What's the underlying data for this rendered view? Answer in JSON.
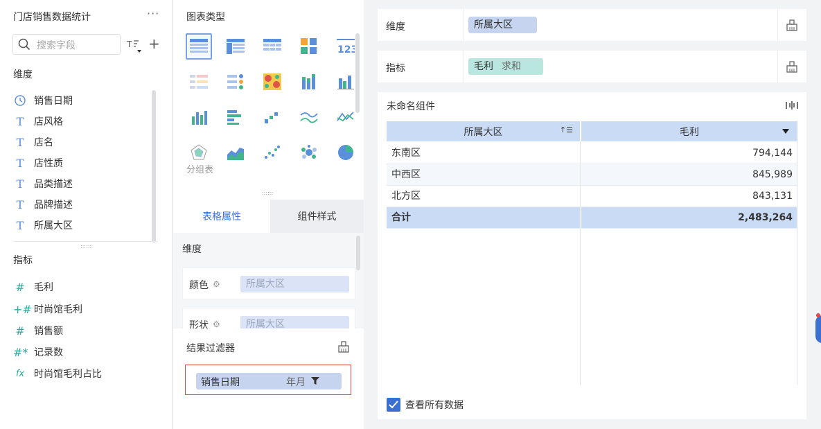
{
  "left": {
    "title": "门店销售数据统计",
    "more": "···",
    "search_placeholder": "搜索字段",
    "dimensions_label": "维度",
    "dimensions": [
      "销售日期",
      "店风格",
      "店名",
      "店性质",
      "品类描述",
      "品牌描述",
      "所属大区"
    ],
    "metrics_label": "指标",
    "metrics": [
      "毛利",
      "时尚馆毛利",
      "销售额",
      "记录数",
      "时尚馆毛利占比"
    ]
  },
  "mid": {
    "chart_types_label": "图表类型",
    "selected_chart_label": "分组表",
    "tabs": [
      "表格属性",
      "组件样式"
    ],
    "dimension_label": "维度",
    "props": [
      {
        "label": "颜色",
        "value": "所属大区"
      },
      {
        "label": "形状",
        "value": "所属大区"
      }
    ],
    "result_filter_label": "结果过滤器",
    "filter": {
      "field": "销售日期",
      "granularity": "年月"
    }
  },
  "right": {
    "dimension_bar_label": "维度",
    "dimension_pill": "所属大区",
    "metric_bar_label": "指标",
    "metric_pill": "毛利",
    "metric_agg": "求和",
    "widget_title": "未命名组件",
    "columns": [
      "所属大区",
      "毛利"
    ],
    "rows": [
      {
        "region": "东南区",
        "value": "794,144"
      },
      {
        "region": "中西区",
        "value": "845,989"
      },
      {
        "region": "北方区",
        "value": "843,131"
      }
    ],
    "total": {
      "label": "合计",
      "value": "2,483,264"
    },
    "view_all": "查看所有数据"
  },
  "colors": {
    "accent": "#3b6fd1",
    "header": "#c9dbf5",
    "metric": "#2fa79a",
    "highlight": "#e04848"
  }
}
